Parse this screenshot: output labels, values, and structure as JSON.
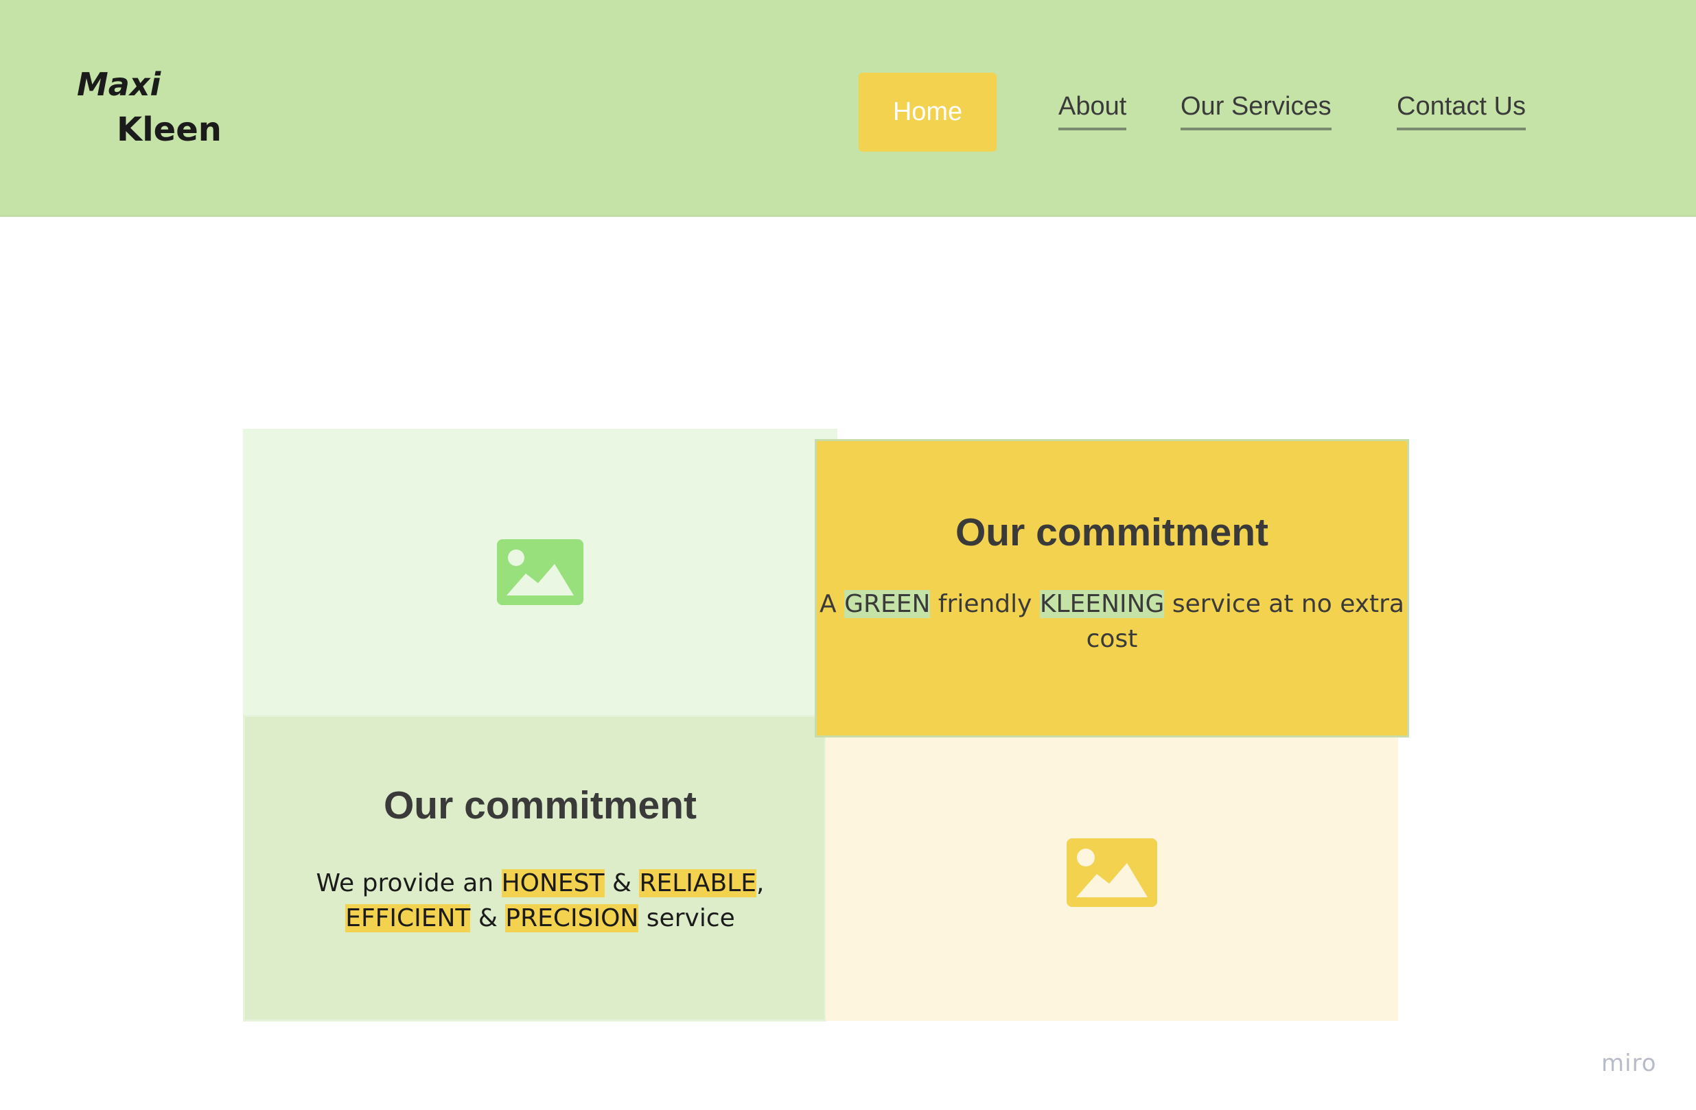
{
  "logo": {
    "line1": "Maxi",
    "line2": "Kleen"
  },
  "nav": {
    "home": "Home",
    "about": "About",
    "services": "Our Services",
    "contact": "Contact Us"
  },
  "cards": {
    "top": {
      "title": "Our commitment",
      "body": {
        "t1": "A ",
        "h1": "GREEN",
        "t2": " friendly ",
        "h2": "KLEENING",
        "t3": " service at no extra cost"
      }
    },
    "bottom": {
      "title": "Our commitment",
      "body": {
        "t1": "We provide an ",
        "h1": "HONEST",
        "t2": " & ",
        "h2": "RELIABLE",
        "t3": ",",
        "h3": "EFFICIENT",
        "t4": " & ",
        "h4": "PRECISION",
        "t5": " service"
      }
    }
  },
  "icons": {
    "top_left": "image-placeholder-icon",
    "bottom_right": "image-placeholder-icon"
  },
  "colors": {
    "header_bg": "#c5e3a6",
    "accent_yellow": "#f2d24f",
    "accent_green": "#98e07c",
    "text_dark": "#3a3a3a"
  },
  "watermark": "miro"
}
